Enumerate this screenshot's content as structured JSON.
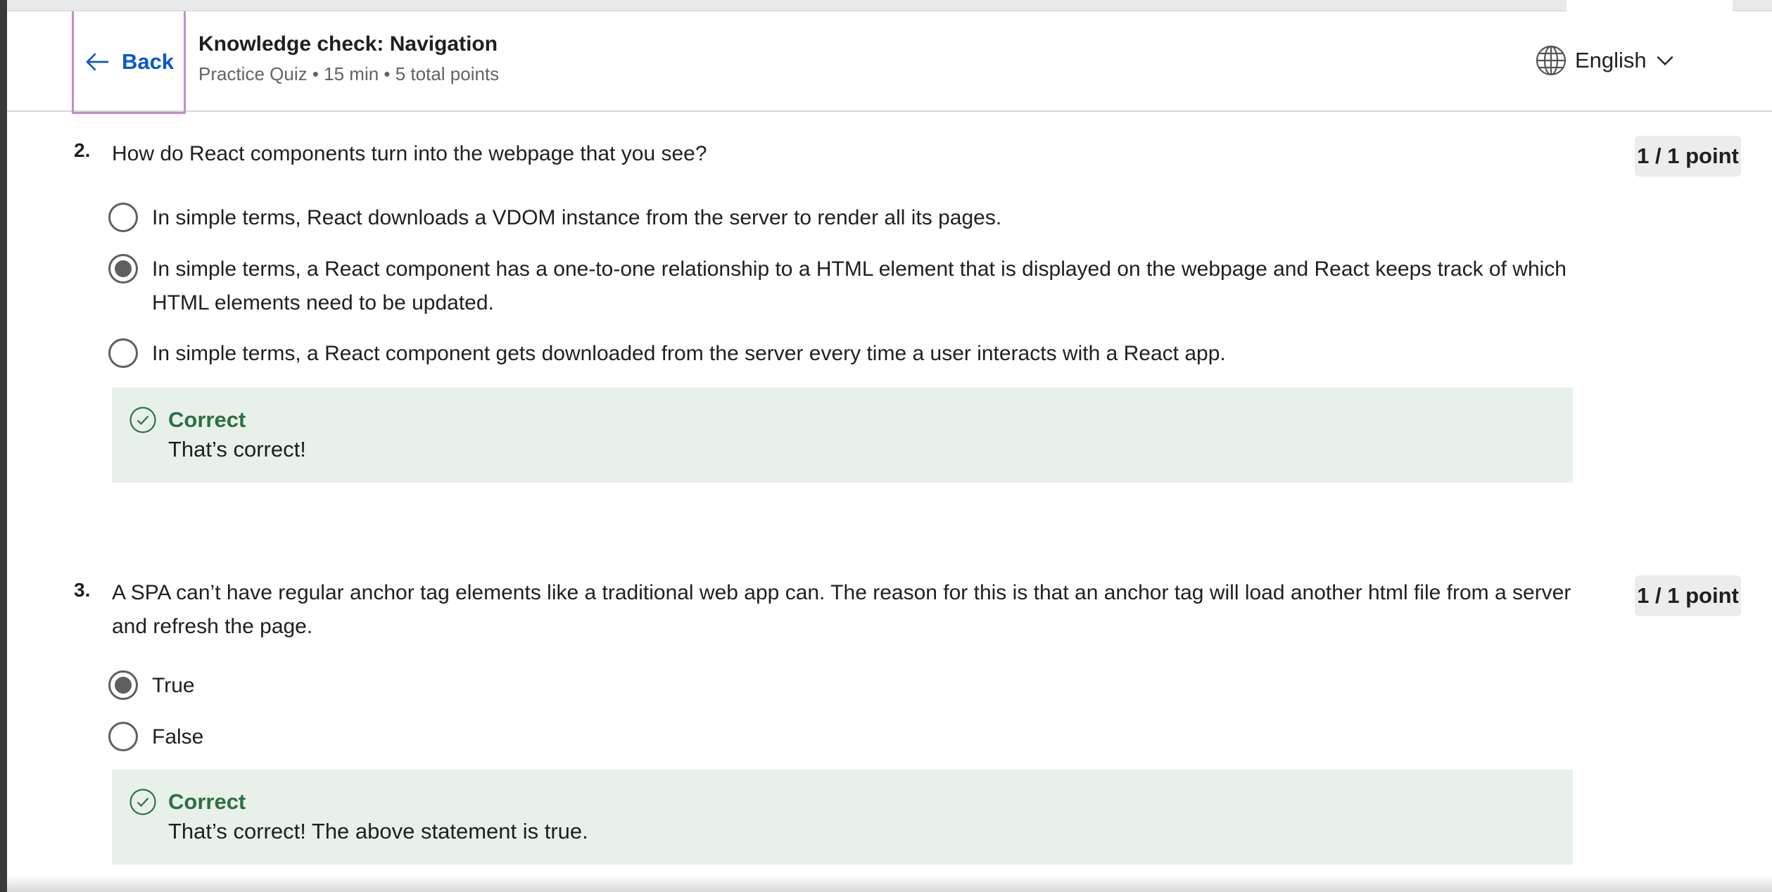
{
  "header": {
    "back_label": "Back",
    "title": "Knowledge check: Navigation",
    "subtitle": "Practice Quiz • 15 min • 5 total points",
    "language": "English"
  },
  "questions": [
    {
      "number": "2.",
      "text": "How do React components turn into the webpage that you see?",
      "points": "1 / 1 point",
      "options": [
        {
          "label": "In simple terms, React downloads a VDOM instance from the server to render all its pages.",
          "selected": false
        },
        {
          "label": "In simple terms, a React component has a one-to-one relationship to a HTML element that is displayed on the webpage and React keeps track of which HTML elements need to be updated.",
          "selected": true
        },
        {
          "label": "In simple terms, a React component gets downloaded from the server every time a user interacts with a React app.",
          "selected": false
        }
      ],
      "feedback": {
        "title": "Correct",
        "message": "That’s correct!"
      }
    },
    {
      "number": "3.",
      "text": "A SPA can’t have regular anchor tag elements like a traditional web app can. The reason for this is that an anchor tag will load another html file from a server and refresh the page.",
      "points": "1 / 1 point",
      "options": [
        {
          "label": "True",
          "selected": true
        },
        {
          "label": "False",
          "selected": false
        }
      ],
      "feedback": {
        "title": "Correct",
        "message": "That’s correct! The above statement is true."
      }
    }
  ],
  "colors": {
    "accent": "#0b57d0",
    "correct_bg": "#e7f1ea",
    "correct_text": "#2e6f43",
    "focus_outline": "#c28fc9"
  },
  "icons": {
    "back": "arrow-left-icon",
    "language": "globe-icon",
    "dropdown": "chevron-down-icon",
    "correct": "check-circle-icon"
  }
}
